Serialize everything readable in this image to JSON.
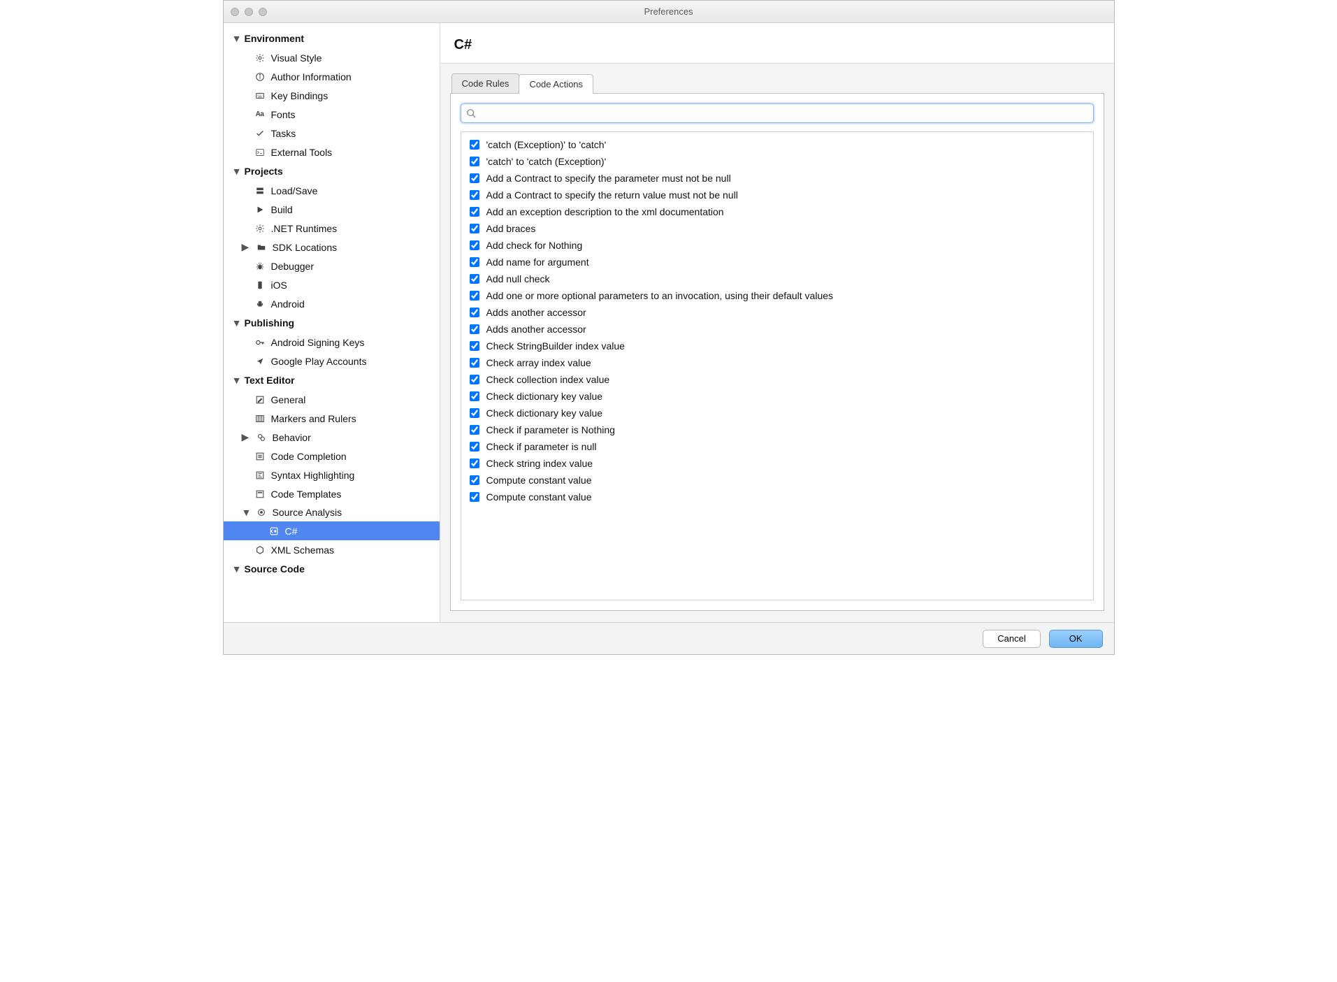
{
  "window": {
    "title": "Preferences"
  },
  "header": {
    "title": "C#"
  },
  "tabs": [
    {
      "label": "Code Rules",
      "active": false
    },
    {
      "label": "Code Actions",
      "active": true
    }
  ],
  "search": {
    "placeholder": ""
  },
  "actions": [
    {
      "checked": true,
      "label": "'catch (Exception)' to 'catch'"
    },
    {
      "checked": true,
      "label": "'catch' to 'catch (Exception)'"
    },
    {
      "checked": true,
      "label": "Add a Contract to specify the parameter must not be null"
    },
    {
      "checked": true,
      "label": "Add a Contract to specify the return value must not be null"
    },
    {
      "checked": true,
      "label": "Add an exception description to the xml documentation"
    },
    {
      "checked": true,
      "label": "Add braces"
    },
    {
      "checked": true,
      "label": "Add check for Nothing"
    },
    {
      "checked": true,
      "label": "Add name for argument"
    },
    {
      "checked": true,
      "label": "Add null check"
    },
    {
      "checked": true,
      "label": "Add one or more optional parameters to an invocation, using their default values"
    },
    {
      "checked": true,
      "label": "Adds another accessor"
    },
    {
      "checked": true,
      "label": "Adds another accessor"
    },
    {
      "checked": true,
      "label": "Check StringBuilder index value"
    },
    {
      "checked": true,
      "label": "Check array index value"
    },
    {
      "checked": true,
      "label": "Check collection index value"
    },
    {
      "checked": true,
      "label": "Check dictionary key value"
    },
    {
      "checked": true,
      "label": "Check dictionary key value"
    },
    {
      "checked": true,
      "label": "Check if parameter is Nothing"
    },
    {
      "checked": true,
      "label": "Check if parameter is null"
    },
    {
      "checked": true,
      "label": "Check string index value"
    },
    {
      "checked": true,
      "label": "Compute constant value"
    },
    {
      "checked": true,
      "label": "Compute constant value"
    }
  ],
  "buttons": {
    "cancel": "Cancel",
    "ok": "OK"
  },
  "sidebar": {
    "groups": [
      {
        "label": "Environment",
        "expanded": true,
        "items": [
          {
            "label": "Visual Style",
            "icon": "gear-icon"
          },
          {
            "label": "Author Information",
            "icon": "info-icon"
          },
          {
            "label": "Key Bindings",
            "icon": "keyboard-icon"
          },
          {
            "label": "Fonts",
            "icon": "fonts-icon"
          },
          {
            "label": "Tasks",
            "icon": "check-icon"
          },
          {
            "label": "External Tools",
            "icon": "terminal-icon"
          }
        ]
      },
      {
        "label": "Projects",
        "expanded": true,
        "items": [
          {
            "label": "Load/Save",
            "icon": "disk-icon"
          },
          {
            "label": "Build",
            "icon": "play-icon"
          },
          {
            "label": ".NET Runtimes",
            "icon": "gear-icon"
          },
          {
            "label": "SDK Locations",
            "icon": "folder-icon",
            "expandable": true
          },
          {
            "label": "Debugger",
            "icon": "bug-icon"
          },
          {
            "label": "iOS",
            "icon": "phone-icon"
          },
          {
            "label": "Android",
            "icon": "android-icon"
          }
        ]
      },
      {
        "label": "Publishing",
        "expanded": true,
        "items": [
          {
            "label": "Android Signing Keys",
            "icon": "key-icon"
          },
          {
            "label": "Google Play Accounts",
            "icon": "publish-icon"
          }
        ]
      },
      {
        "label": "Text Editor",
        "expanded": true,
        "items": [
          {
            "label": "General",
            "icon": "edit-icon"
          },
          {
            "label": "Markers and Rulers",
            "icon": "rulers-icon"
          },
          {
            "label": "Behavior",
            "icon": "behavior-icon",
            "expandable": true
          },
          {
            "label": "Code Completion",
            "icon": "list-icon"
          },
          {
            "label": "Syntax Highlighting",
            "icon": "highlight-icon"
          },
          {
            "label": "Code Templates",
            "icon": "template-icon"
          },
          {
            "label": "Source Analysis",
            "icon": "target-icon",
            "expandable": true,
            "expanded": true,
            "children": [
              {
                "label": "C#",
                "icon": "csharp-icon",
                "selected": true
              }
            ]
          },
          {
            "label": "XML Schemas",
            "icon": "xml-icon"
          }
        ]
      },
      {
        "label": "Source Code",
        "expanded": true,
        "items": []
      }
    ]
  }
}
